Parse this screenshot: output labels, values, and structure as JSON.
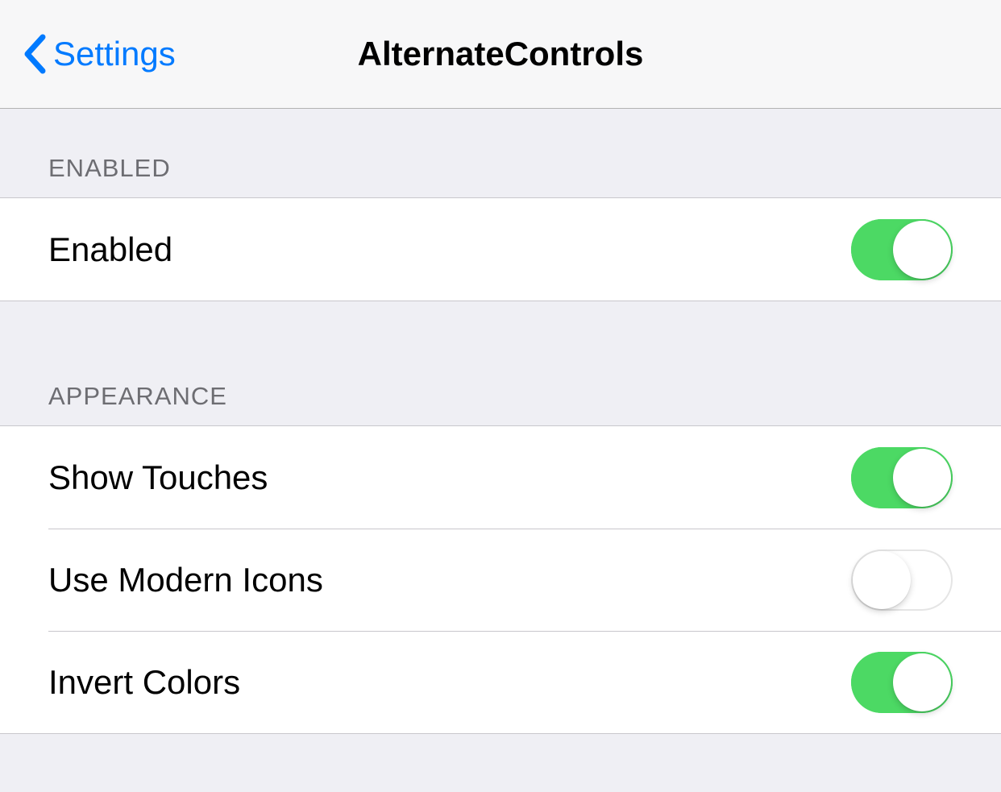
{
  "nav": {
    "back_label": "Settings",
    "title": "AlternateControls"
  },
  "sections": {
    "enabled": {
      "header": "ENABLED",
      "items": [
        {
          "label": "Enabled",
          "value": true
        }
      ]
    },
    "appearance": {
      "header": "APPEARANCE",
      "items": [
        {
          "label": "Show Touches",
          "value": true
        },
        {
          "label": "Use Modern Icons",
          "value": false
        },
        {
          "label": "Invert Colors",
          "value": true
        }
      ]
    }
  },
  "colors": {
    "accent": "#007aff",
    "toggle_on": "#4cd964",
    "background": "#efeff4"
  }
}
